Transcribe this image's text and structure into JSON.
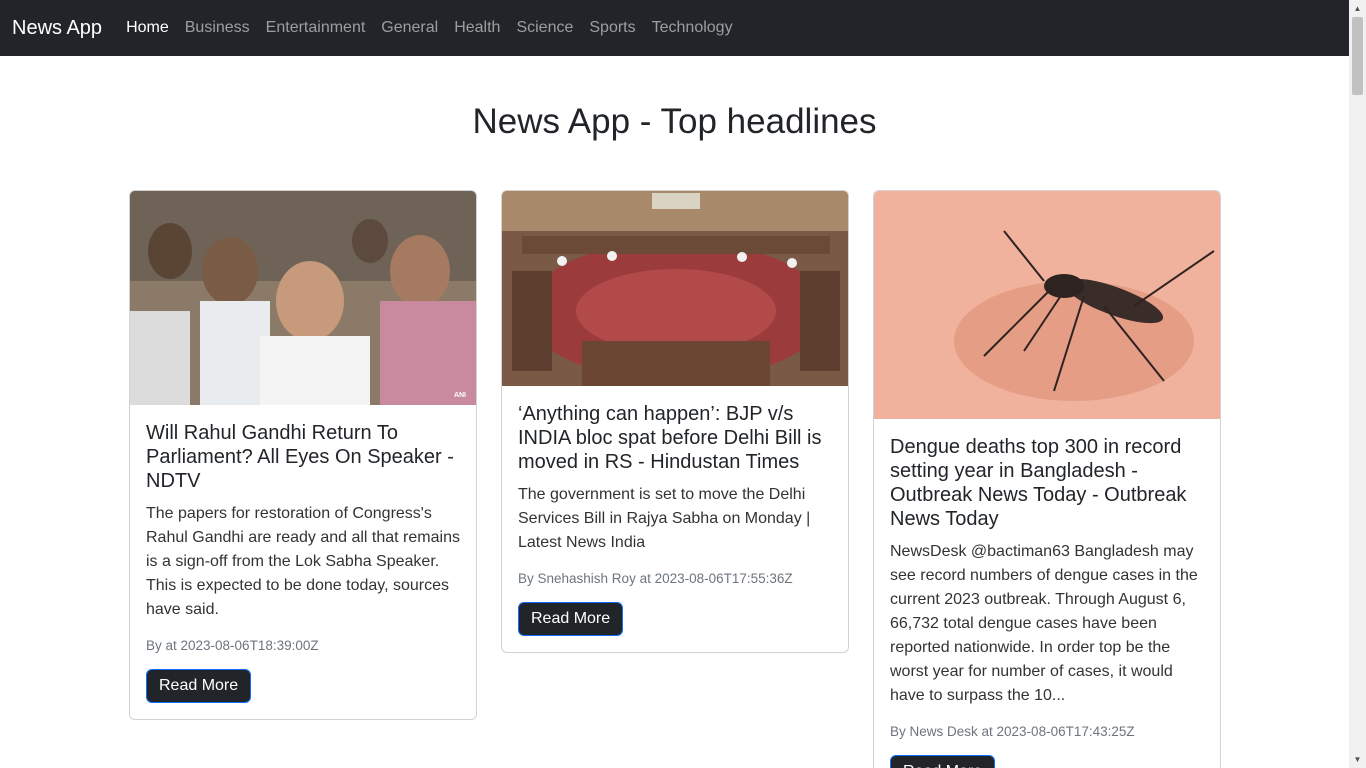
{
  "navbar": {
    "brand": "News App",
    "links": [
      {
        "label": "Home",
        "active": true
      },
      {
        "label": "Business"
      },
      {
        "label": "Entertainment"
      },
      {
        "label": "General"
      },
      {
        "label": "Health"
      },
      {
        "label": "Science"
      },
      {
        "label": "Sports"
      },
      {
        "label": "Technology"
      }
    ]
  },
  "main": {
    "title": "News App - Top headlines"
  },
  "articles": [
    {
      "title": "Will Rahul Gandhi Return To Parliament? All Eyes On Speaker - NDTV",
      "description": "The papers for restoration of Congress's Rahul Gandhi are ready and all that remains is a sign-off from the Lok Sabha Speaker. This is expected to be done today, sources have said.",
      "meta": "By at 2023-08-06T18:39:00Z",
      "button": "Read More",
      "image_tag": "ANI",
      "image_icon": "people-photo"
    },
    {
      "title": "‘Anything can happen’: BJP v/s INDIA bloc spat before Delhi Bill is moved in RS - Hindustan Times",
      "description": "The government is set to move the Delhi Services Bill in Rajya Sabha on Monday | Latest News India",
      "meta": "By Snehashish Roy at 2023-08-06T17:55:36Z",
      "button": "Read More",
      "image_icon": "parliament-photo"
    },
    {
      "title": "Dengue deaths top 300 in record setting year in Bangladesh - Outbreak News Today - Outbreak News Today",
      "description": "NewsDesk @bactiman63 Bangladesh may see record numbers of dengue cases in the current 2023 outbreak. Through August 6, 66,732 total dengue cases have been reported nationwide. In order top be the worst year for number of cases, it would have to surpass the 10...",
      "meta": "By News Desk at 2023-08-06T17:43:25Z",
      "button": "Read More",
      "image_icon": "mosquito-photo"
    }
  ],
  "colors": {
    "navbar_bg": "#212529",
    "button_bg": "#212529",
    "button_border": "#0d6efd"
  }
}
